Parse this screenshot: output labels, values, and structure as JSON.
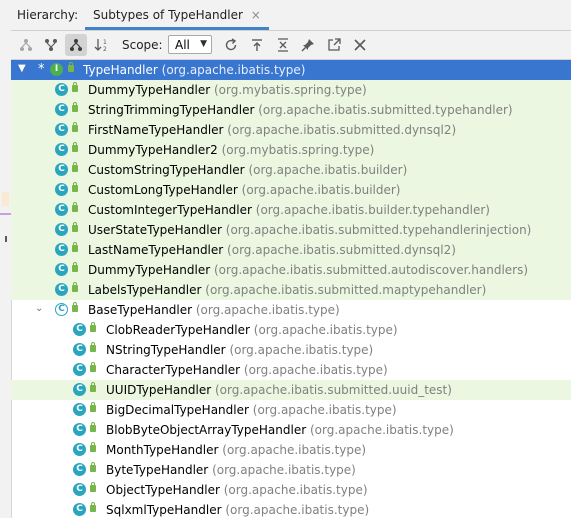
{
  "header": {
    "label": "Hierarchy:",
    "tab_title": "Subtypes of TypeHandler",
    "tab_close": "×"
  },
  "toolbar": {
    "scope_label": "Scope:",
    "scope_value": "All",
    "buttons": [
      "class-hierarchy-icon",
      "supertypes-hierarchy-icon",
      "subtypes-hierarchy-icon",
      "sort-alphabetically-icon",
      "refresh-icon",
      "export-icon",
      "expand-all-icon",
      "pin-icon",
      "open-in-window-icon",
      "close-icon"
    ]
  },
  "tree": {
    "root": {
      "name": "TypeHandler",
      "pkg": "(org.apache.ibatis.type)",
      "marker": "*"
    },
    "direct": [
      {
        "name": "DummyTypeHandler",
        "pkg": "(org.mybatis.spring.type)"
      },
      {
        "name": "StringTrimmingTypeHandler",
        "pkg": "(org.apache.ibatis.submitted.typehandler)"
      },
      {
        "name": "FirstNameTypeHandler",
        "pkg": "(org.apache.ibatis.submitted.dynsql2)"
      },
      {
        "name": "DummyTypeHandler2",
        "pkg": "(org.mybatis.spring.type)"
      },
      {
        "name": "CustomStringTypeHandler",
        "pkg": "(org.apache.ibatis.builder)"
      },
      {
        "name": "CustomLongTypeHandler",
        "pkg": "(org.apache.ibatis.builder)"
      },
      {
        "name": "CustomIntegerTypeHandler",
        "pkg": "(org.apache.ibatis.builder.typehandler)"
      },
      {
        "name": "UserStateTypeHandler",
        "pkg": "(org.apache.ibatis.submitted.typehandlerinjection)"
      },
      {
        "name": "LastNameTypeHandler",
        "pkg": "(org.apache.ibatis.submitted.dynsql2)"
      },
      {
        "name": "DummyTypeHandler",
        "pkg": "(org.apache.ibatis.submitted.autodiscover.handlers)"
      },
      {
        "name": "LabelsTypeHandler",
        "pkg": "(org.apache.ibatis.submitted.maptypehandler)"
      }
    ],
    "base": {
      "name": "BaseTypeHandler",
      "pkg": "(org.apache.ibatis.type)"
    },
    "base_children": [
      {
        "name": "ClobReaderTypeHandler",
        "pkg": "(org.apache.ibatis.type)"
      },
      {
        "name": "NStringTypeHandler",
        "pkg": "(org.apache.ibatis.type)"
      },
      {
        "name": "CharacterTypeHandler",
        "pkg": "(org.apache.ibatis.type)"
      },
      {
        "name": "UUIDTypeHandler",
        "pkg": "(org.apache.ibatis.submitted.uuid_test)"
      },
      {
        "name": "BigDecimalTypeHandler",
        "pkg": "(org.apache.ibatis.type)"
      },
      {
        "name": "BlobByteObjectArrayTypeHandler",
        "pkg": "(org.apache.ibatis.type)"
      },
      {
        "name": "MonthTypeHandler",
        "pkg": "(org.apache.ibatis.type)"
      },
      {
        "name": "ByteTypeHandler",
        "pkg": "(org.apache.ibatis.type)"
      },
      {
        "name": "ObjectTypeHandler",
        "pkg": "(org.apache.ibatis.type)"
      },
      {
        "name": "SqlxmlTypeHandler",
        "pkg": "(org.apache.ibatis.type)"
      }
    ]
  }
}
